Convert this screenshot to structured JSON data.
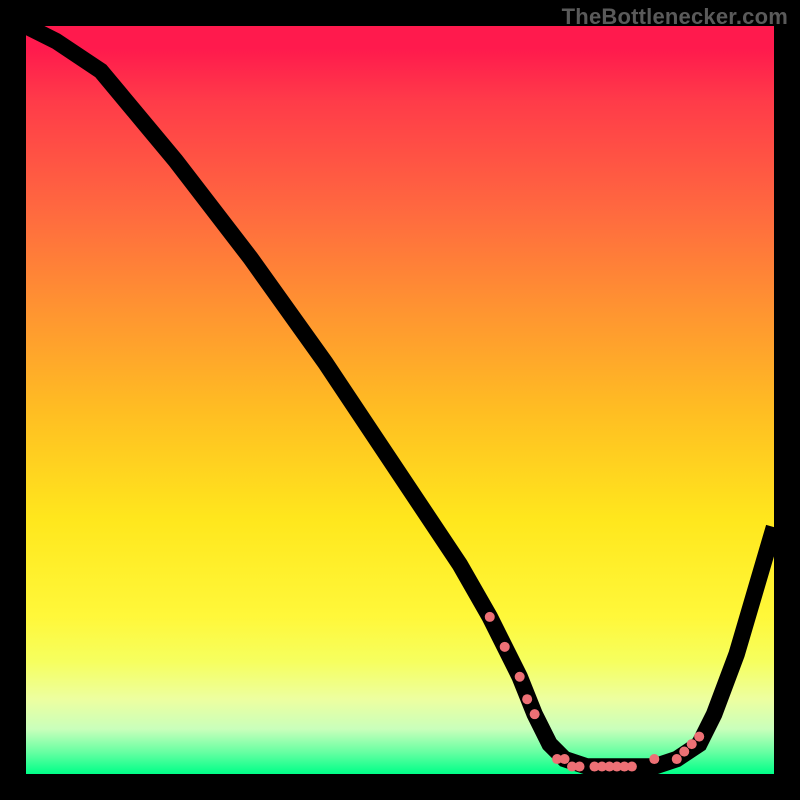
{
  "watermark": "TheBottlenecker.com",
  "chart_data": {
    "type": "line",
    "title": "",
    "xlabel": "",
    "ylabel": "",
    "xlim": [
      0,
      100
    ],
    "ylim": [
      0,
      100
    ],
    "background_gradient": {
      "direction": "vertical",
      "meaning": "bottleneck-severity",
      "stops": [
        {
          "pos": 0.0,
          "color": "#ff1a4d"
        },
        {
          "pos": 0.25,
          "color": "#ff6a3f"
        },
        {
          "pos": 0.52,
          "color": "#ffbf22"
        },
        {
          "pos": 0.79,
          "color": "#fff83a"
        },
        {
          "pos": 0.94,
          "color": "#c9ffbb"
        },
        {
          "pos": 1.0,
          "color": "#00ff88"
        }
      ]
    },
    "series": [
      {
        "name": "bottleneck-curve",
        "x": [
          0,
          4,
          10,
          20,
          30,
          40,
          50,
          58,
          62,
          66,
          68,
          70,
          72,
          75,
          78,
          80,
          82,
          84,
          87,
          90,
          92,
          95,
          100
        ],
        "y": [
          100,
          98,
          94,
          82,
          69,
          55,
          40,
          28,
          21,
          13,
          8,
          4,
          2,
          1,
          1,
          1,
          1,
          1,
          2,
          4,
          8,
          16,
          33
        ]
      }
    ],
    "markers": {
      "name": "data-points",
      "color": "#ed7075",
      "radius": 5,
      "points": [
        {
          "x": 62,
          "y": 21
        },
        {
          "x": 64,
          "y": 17
        },
        {
          "x": 66,
          "y": 13
        },
        {
          "x": 67,
          "y": 10
        },
        {
          "x": 68,
          "y": 8
        },
        {
          "x": 71,
          "y": 2
        },
        {
          "x": 72,
          "y": 2
        },
        {
          "x": 73,
          "y": 1
        },
        {
          "x": 74,
          "y": 1
        },
        {
          "x": 76,
          "y": 1
        },
        {
          "x": 77,
          "y": 1
        },
        {
          "x": 78,
          "y": 1
        },
        {
          "x": 79,
          "y": 1
        },
        {
          "x": 80,
          "y": 1
        },
        {
          "x": 81,
          "y": 1
        },
        {
          "x": 84,
          "y": 2
        },
        {
          "x": 87,
          "y": 2
        },
        {
          "x": 88,
          "y": 3
        },
        {
          "x": 89,
          "y": 4
        },
        {
          "x": 90,
          "y": 5
        }
      ]
    }
  }
}
